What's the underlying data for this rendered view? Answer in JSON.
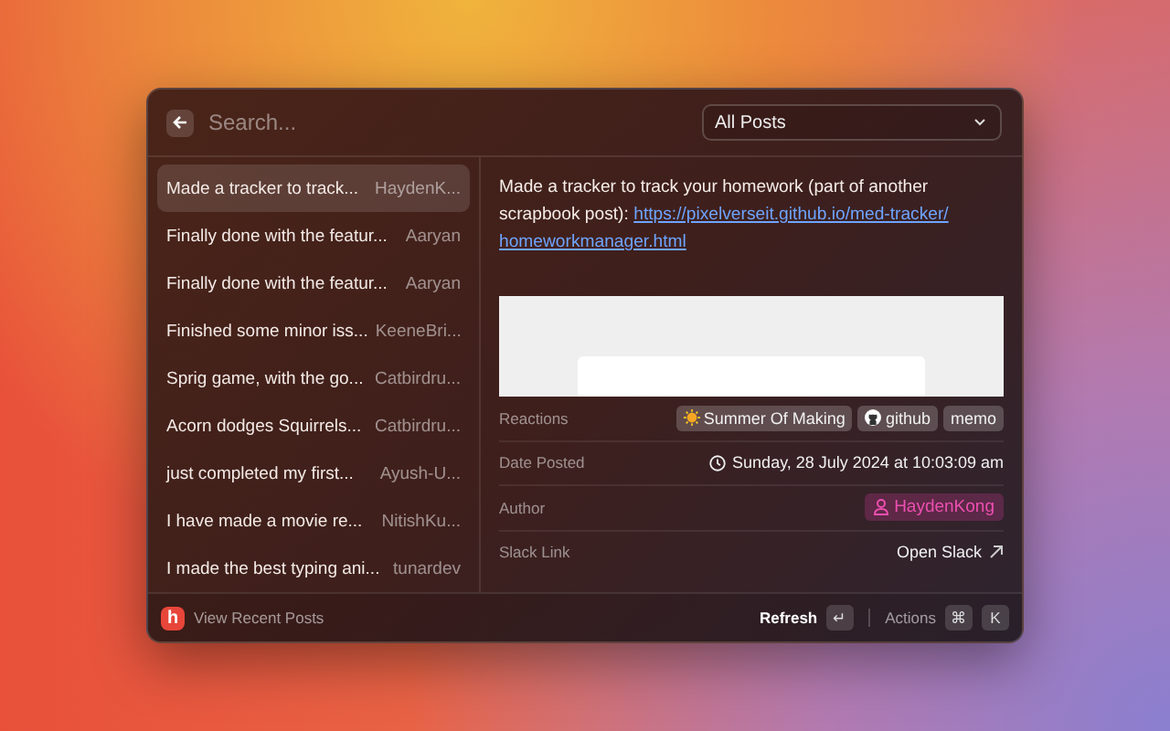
{
  "search": {
    "placeholder": "Search..."
  },
  "filter": {
    "value": "All Posts"
  },
  "posts": [
    {
      "title": "Made a tracker to track...",
      "author": "HaydenK...",
      "selected": true
    },
    {
      "title": "Finally done with the featur...",
      "author": "Aaryan",
      "selected": false
    },
    {
      "title": "Finally done with the featur...",
      "author": "Aaryan",
      "selected": false
    },
    {
      "title": "Finished some minor iss...",
      "author": "KeeneBri...",
      "selected": false
    },
    {
      "title": "Sprig game, with the go...",
      "author": "Catbirdru...",
      "selected": false
    },
    {
      "title": "Acorn dodges Squirrels...",
      "author": "Catbirdru...",
      "selected": false
    },
    {
      "title": "just completed my first...",
      "author": "Ayush-U...",
      "selected": false
    },
    {
      "title": "I have made a movie re...",
      "author": "NitishKu...",
      "selected": false
    },
    {
      "title": "I made the best typing ani...",
      "author": "tunardev",
      "selected": false
    }
  ],
  "detail": {
    "text": "Made a tracker to track your homework (part of another scrapbook post):",
    "link_lines": [
      "https://pixelverseit.github.io/med-tracker/",
      "homeworkmanager.html"
    ],
    "fields": [
      {
        "label": "Reactions",
        "kind": "reactions",
        "reactions": [
          {
            "label": "Summer Of Making",
            "kind": "sun"
          },
          {
            "label": "github",
            "kind": "github"
          },
          {
            "label": "memo",
            "kind": "plain"
          }
        ]
      },
      {
        "label": "Date Posted",
        "kind": "date",
        "value": "Sunday, 28 July 2024 at 10:03:09 am"
      },
      {
        "label": "Author",
        "kind": "author",
        "value": "HaydenKong"
      },
      {
        "label": "Slack Link",
        "kind": "link",
        "value": "Open Slack"
      }
    ]
  },
  "footer": {
    "logo": "h",
    "title": "View Recent Posts",
    "primary_action": "Refresh",
    "primary_key": "↵",
    "secondary_action": "Actions",
    "secondary_keys": [
      "⌘",
      "K"
    ]
  }
}
